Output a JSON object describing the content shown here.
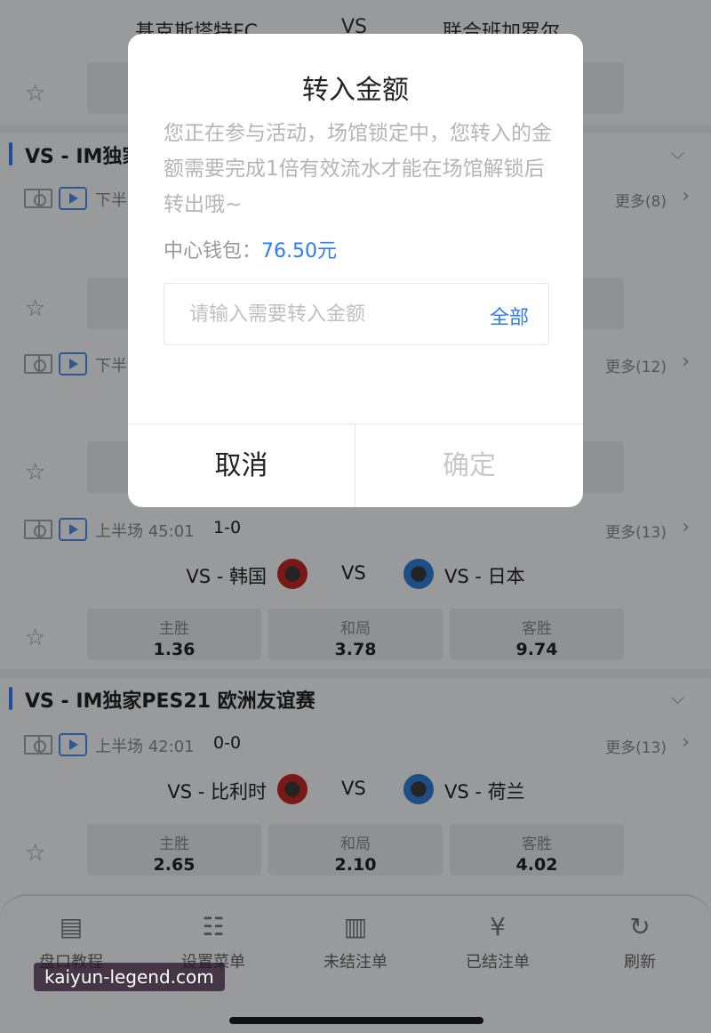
{
  "top_match": {
    "home": "基克斯塔特FC",
    "vs": "VS",
    "away": "联合班加罗尔"
  },
  "leagues": [
    {
      "name": "VS - IM独家"
    },
    {
      "name": "VS - IM独家PES21 欧洲友谊赛"
    }
  ],
  "matches": [
    {
      "status": "下半场",
      "more": "更多(8)"
    },
    {
      "status": "下半场",
      "more": "更多(12)"
    },
    {
      "status": "上半场 45:01",
      "score": "1-0",
      "more": "更多(13)",
      "home": "VS - 韩国",
      "vs": "VS",
      "away": "VS - 日本",
      "odds": [
        {
          "label": "主胜",
          "value": "1.36"
        },
        {
          "label": "和局",
          "value": "3.78"
        },
        {
          "label": "客胜",
          "value": "9.74"
        }
      ]
    },
    {
      "status": "上半场 42:01",
      "score": "0-0",
      "more": "更多(13)",
      "home": "VS - 比利时",
      "vs": "VS",
      "away": "VS - 荷兰",
      "odds": [
        {
          "label": "主胜",
          "value": "2.65"
        },
        {
          "label": "和局",
          "value": "2.10"
        },
        {
          "label": "客胜",
          "value": "4.02"
        }
      ]
    }
  ],
  "bottom_nav": [
    {
      "label": "盘口教程",
      "icon": "document-icon"
    },
    {
      "label": "设置菜单",
      "icon": "sliders-icon"
    },
    {
      "label": "未结注单",
      "icon": "clipboard-icon"
    },
    {
      "label": "已结注单",
      "icon": "yuan-clipboard-icon"
    },
    {
      "label": "刷新",
      "icon": "refresh-icon"
    }
  ],
  "watermark": "kaiyun-legend.com",
  "dialog": {
    "title": "转入金额",
    "description": "您正在参与活动，场馆锁定中，您转入的金额需要完成1倍有效流水才能在场馆解锁后转出哦~",
    "wallet_label": "中心钱包：",
    "wallet_amount": "76.50元",
    "input_placeholder": "请输入需要转入金额",
    "all_label": "全部",
    "cancel_label": "取消",
    "confirm_label": "确定"
  },
  "colors": {
    "accent": "#2d7cf6",
    "overlay": "rgba(0,0,0,0.38)"
  }
}
